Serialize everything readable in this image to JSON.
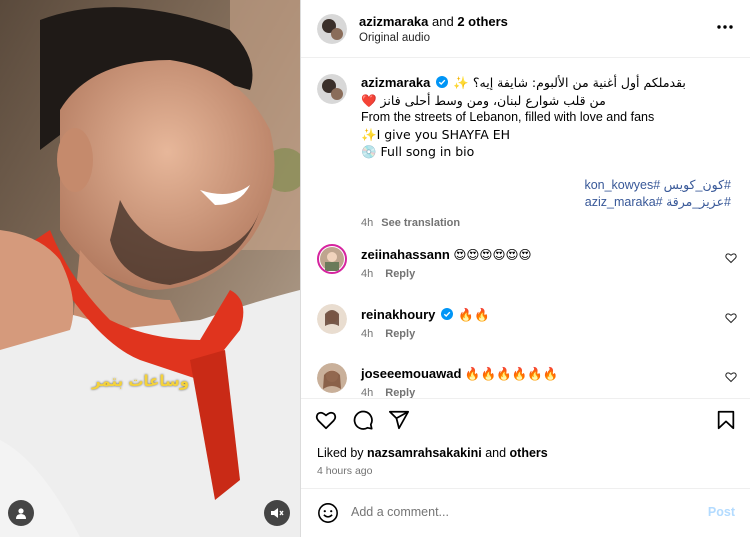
{
  "media": {
    "overlay_caption": "وساعات بتمر"
  },
  "header": {
    "username": "azizmaraka",
    "and_text": "and",
    "others": "2 others",
    "audio": "Original audio"
  },
  "post": {
    "username": "azizmaraka",
    "line1": "بقدملكم أول أغنية من الألبوم: شايفة إيه؟ ✨",
    "line2": "من قلب شوارع لبنان، ومن وسط أحلى فانز ❤️",
    "line3": "From the streets of Lebanon, filled with love and fans",
    "line4": "✨I give you SHAYFA EH",
    "line5": "💿 Full song in bio",
    "hashtag1": "#كون_كويس #kon_kowyes",
    "hashtag2": "#عزيز_مرقة #aziz_maraka",
    "time": "4h",
    "see_translation": "See translation"
  },
  "comments": [
    {
      "username": "zeiinahassann",
      "text": "😍😍😍😍😍😍",
      "time": "4h",
      "reply": "Reply"
    },
    {
      "username": "reinakhoury",
      "text": "🔥🔥",
      "time": "4h",
      "reply": "Reply"
    },
    {
      "username": "joseeemouawad",
      "text": "🔥🔥🔥🔥🔥🔥",
      "time": "4h",
      "reply": "Reply"
    }
  ],
  "likes": {
    "prefix": "Liked by",
    "user": "nazsamrahsakakini",
    "and": "and",
    "others": "others",
    "ago": "4 hours ago"
  },
  "add_comment": {
    "placeholder": "Add a comment...",
    "post_label": "Post"
  },
  "colors": {
    "verified": "#0095f6",
    "link": "#385898",
    "post_disabled": "#b3dbff",
    "heart_red": "#ed4956"
  }
}
